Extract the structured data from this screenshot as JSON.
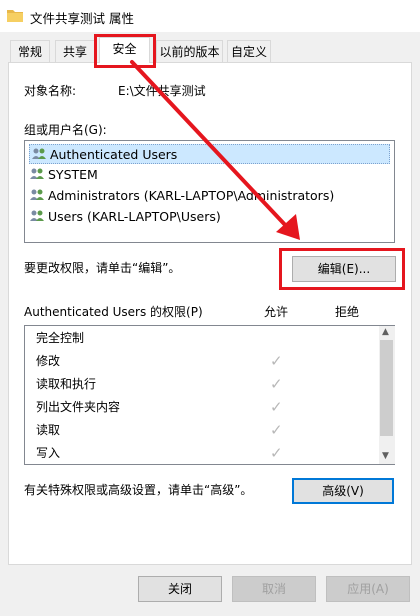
{
  "window": {
    "title": "文件共享测试 属性"
  },
  "tabs": [
    {
      "label": "常规"
    },
    {
      "label": "共享"
    },
    {
      "label": "安全"
    },
    {
      "label": "以前的版本"
    },
    {
      "label": "自定义"
    }
  ],
  "security": {
    "object_label": "对象名称:",
    "object_value": "E:\\文件共享测试",
    "group_label": "组或用户名(G):",
    "groups": [
      {
        "name": "Authenticated Users"
      },
      {
        "name": "SYSTEM"
      },
      {
        "name": "Administrators (KARL-LAPTOP\\Administrators)"
      },
      {
        "name": "Users (KARL-LAPTOP\\Users)"
      }
    ],
    "change_hint": "要更改权限，请单击“编辑”。",
    "edit_button": "编辑(E)...",
    "perm_header": "Authenticated Users 的权限(P)",
    "allow_header": "允许",
    "deny_header": "拒绝",
    "permissions": [
      {
        "name": "完全控制",
        "allow": false
      },
      {
        "name": "修改",
        "allow": true
      },
      {
        "name": "读取和执行",
        "allow": true
      },
      {
        "name": "列出文件夹内容",
        "allow": true
      },
      {
        "name": "读取",
        "allow": true
      },
      {
        "name": "写入",
        "allow": true
      }
    ],
    "advanced_hint": "有关特殊权限或高级设置，请单击“高级”。",
    "advanced_button": "高级(V)"
  },
  "footer": {
    "close": "关闭",
    "cancel": "取消",
    "apply": "应用(A)"
  },
  "colors": {
    "accent": "#0078d7",
    "annotation": "#e5161e",
    "check_gray": "#b8b8b8"
  },
  "icons": [
    "folder-icon",
    "user-group-icon",
    "check-icon",
    "scroll-up-icon",
    "scroll-down-icon"
  ]
}
